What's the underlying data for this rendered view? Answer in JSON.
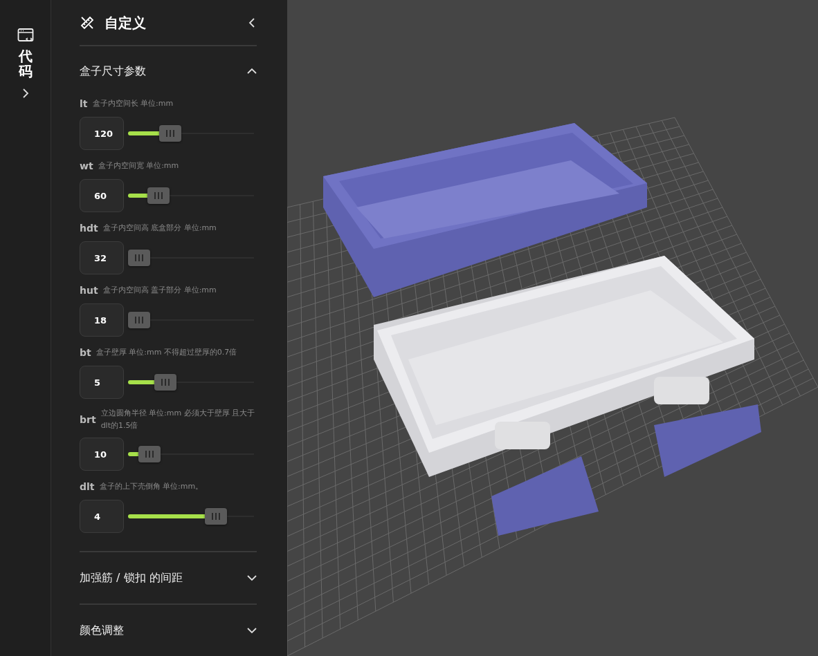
{
  "rail": {
    "label": "代码"
  },
  "panel": {
    "title": "自定义"
  },
  "sections": [
    {
      "title": "盒子尺寸参数",
      "expanded": true,
      "params": [
        {
          "name": "lt",
          "description": "盒子内空间长 单位:mm",
          "value": "120",
          "level": 0.3
        },
        {
          "name": "wt",
          "description": "盒子内空间宽 单位:mm",
          "value": "60",
          "level": 0.19
        },
        {
          "name": "hdt",
          "description": "盒子内空间高 底盒部分 单位:mm",
          "value": "32",
          "level": 0
        },
        {
          "name": "hut",
          "description": "盒子内空间高 盖子部分 单位:mm",
          "value": "18",
          "level": 0
        },
        {
          "name": "bt",
          "description": "盒子壁厚 单位:mm 不得超过壁厚的0.7倍",
          "value": "5",
          "level": 0.25
        },
        {
          "name": "brt",
          "description": "立边圆角半径 单位:mm 必须大于壁厚 且大于dlt的1.5倍",
          "value": "10",
          "level": 0.1
        },
        {
          "name": "dlt",
          "description": "盒子的上下壳倒角 单位:mm。",
          "value": "4",
          "level": 0.74
        }
      ]
    },
    {
      "title": "加强筋 / 锁扣 的间距",
      "expanded": false
    },
    {
      "title": "颜色调整",
      "expanded": false
    }
  ]
}
